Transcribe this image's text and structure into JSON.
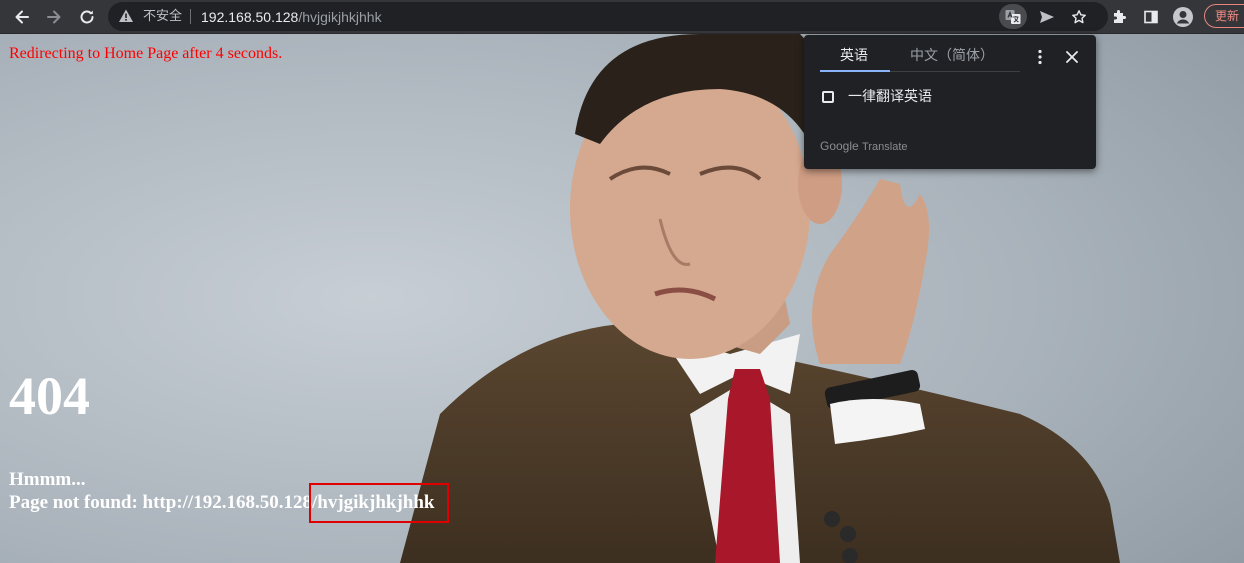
{
  "browser": {
    "security_label": "不安全",
    "url_host": "192.168.50.128",
    "url_path": "/hvjgikjhkjhhk",
    "update_label": "更新",
    "icons": [
      "back-icon",
      "forward-icon",
      "reload-icon",
      "warning-icon",
      "translate-icon",
      "send-icon",
      "star-icon",
      "extensions-icon",
      "side-panel-icon",
      "profile-icon"
    ]
  },
  "page": {
    "redirect_text": "Redirecting to Home Page after 4 seconds.",
    "error_code": "404",
    "hmmm_text": "Hmmm...",
    "not_found_prefix": "Page not found: http://192.168.50.128/",
    "not_found_path": "hvjgikjhkjhhk"
  },
  "translate_popup": {
    "tab_source": "英语",
    "tab_target": "中文（简体）",
    "always_translate_label": "一律翻译英语",
    "always_translate_checked": false,
    "brand_google": "Google",
    "brand_translate": "Translate"
  },
  "colors": {
    "redirect_text": "#ff0000",
    "highlight_box": "#e00000",
    "tab_accent": "#8ab4f8",
    "update_button": "#f28b82"
  }
}
